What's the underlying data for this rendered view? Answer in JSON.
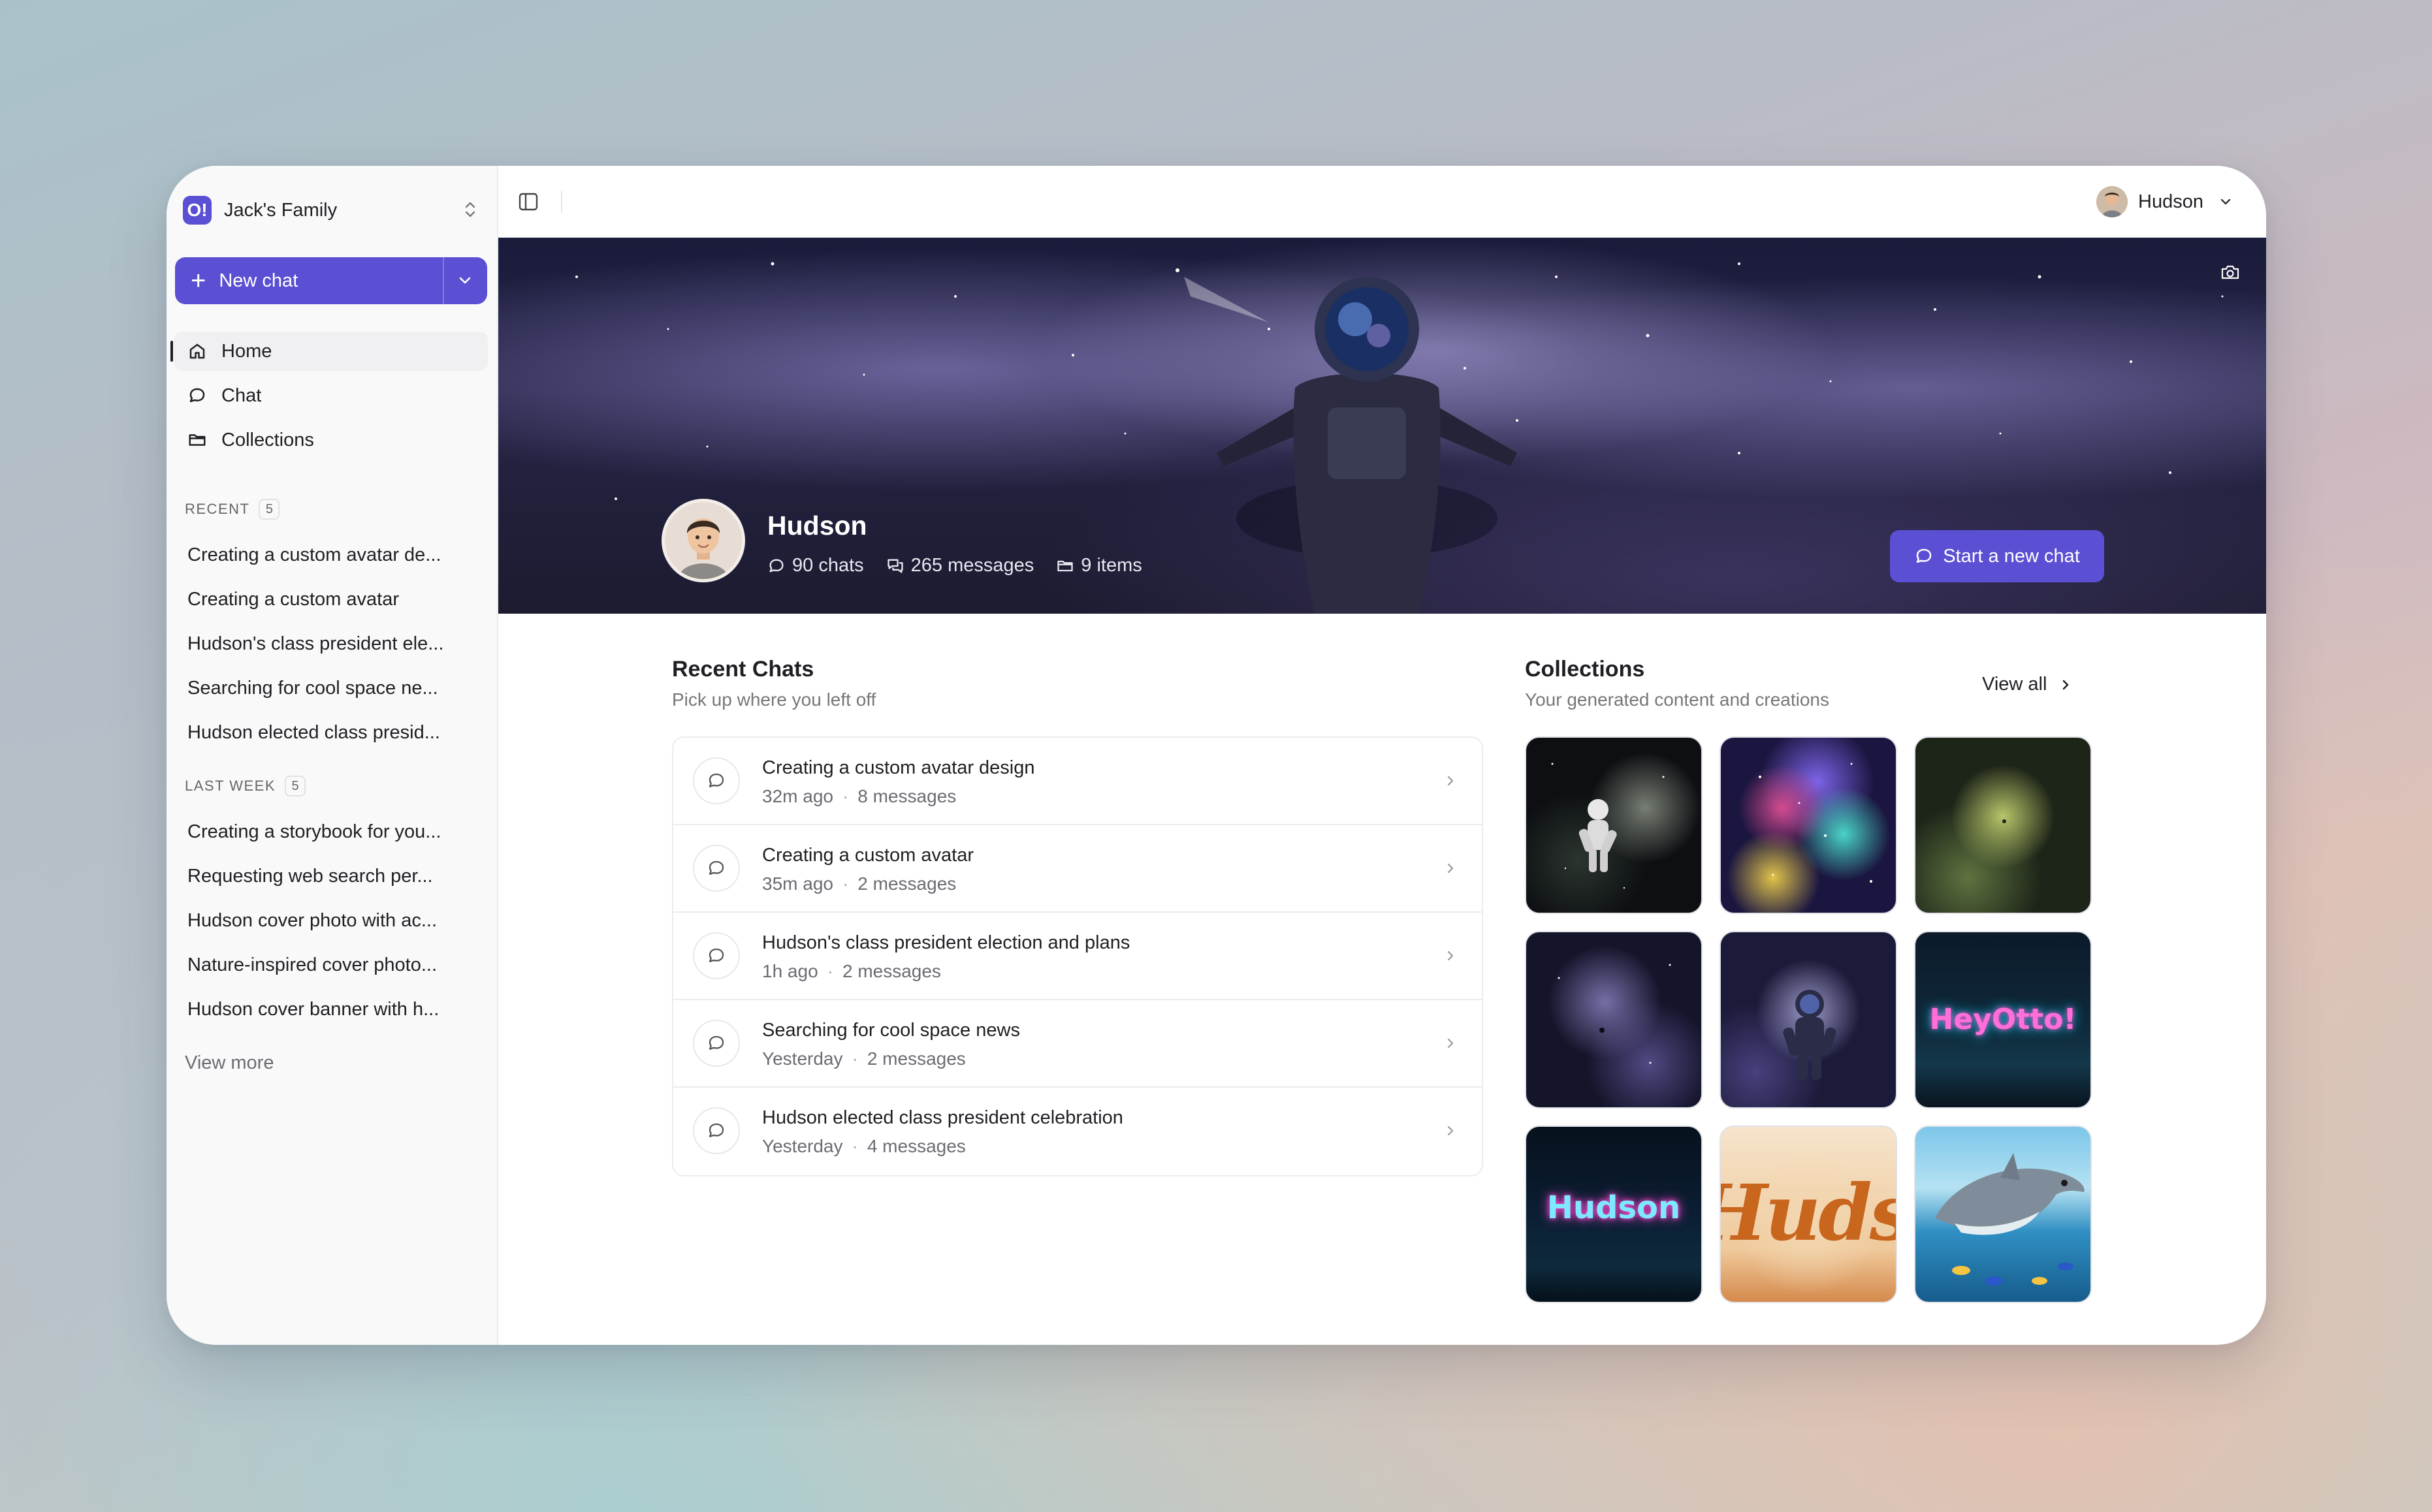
{
  "workspace": {
    "name": "Jack's Family",
    "logo": "O!"
  },
  "sidebar": {
    "new_chat_label": "New chat",
    "nav": [
      {
        "label": "Home",
        "icon": "home-icon"
      },
      {
        "label": "Chat",
        "icon": "chat-bubble-icon"
      },
      {
        "label": "Collections",
        "icon": "folder-icon"
      }
    ],
    "recent": {
      "title": "RECENT",
      "count": "5",
      "items": [
        "Creating a custom avatar de...",
        "Creating a custom avatar",
        "Hudson's class president ele...",
        "Searching for cool space ne...",
        "Hudson elected class presid..."
      ]
    },
    "last_week": {
      "title": "LAST WEEK",
      "count": "5",
      "items": [
        "Creating a storybook for you...",
        "Requesting web search per...",
        "Hudson cover photo with ac...",
        "Nature-inspired cover photo...",
        "Hudson cover banner with h..."
      ]
    },
    "view_more": "View more"
  },
  "topbar": {
    "user_name": "Hudson"
  },
  "profile": {
    "name": "Hudson",
    "chats": "90 chats",
    "messages": "265 messages",
    "items": "9 items",
    "start_chat_label": "Start a new chat"
  },
  "recent_chats": {
    "title": "Recent Chats",
    "subtitle": "Pick up where you left off",
    "rows": [
      {
        "title": "Creating a custom avatar design",
        "time": "32m ago",
        "messages": "8 messages"
      },
      {
        "title": "Creating a custom avatar",
        "time": "35m ago",
        "messages": "2 messages"
      },
      {
        "title": "Hudson's class president election and plans",
        "time": "1h ago",
        "messages": "2 messages"
      },
      {
        "title": "Searching for cool space news",
        "time": "Yesterday",
        "messages": "2 messages"
      },
      {
        "title": "Hudson elected class president celebration",
        "time": "Yesterday",
        "messages": "4 messages"
      }
    ]
  },
  "collections": {
    "title": "Collections",
    "subtitle": "Your generated content and creations",
    "view_all": "View all",
    "tiles": [
      {
        "name": "astronaut-dark-nebula-image"
      },
      {
        "name": "colorful-nebula-image"
      },
      {
        "name": "green-nebula-image"
      },
      {
        "name": "purple-nebula-image"
      },
      {
        "name": "astronaut-purple-nebula-image"
      },
      {
        "name": "neon-sign-image",
        "text": "HeyOtto!"
      },
      {
        "name": "neon-name-image",
        "text": "Hudson"
      },
      {
        "name": "watercolor-name-image",
        "text": "Hudso"
      },
      {
        "name": "dolphin-image"
      }
    ]
  },
  "colors": {
    "accent": "#5b4fd3",
    "sidebar_bg": "#f9f9f9"
  }
}
